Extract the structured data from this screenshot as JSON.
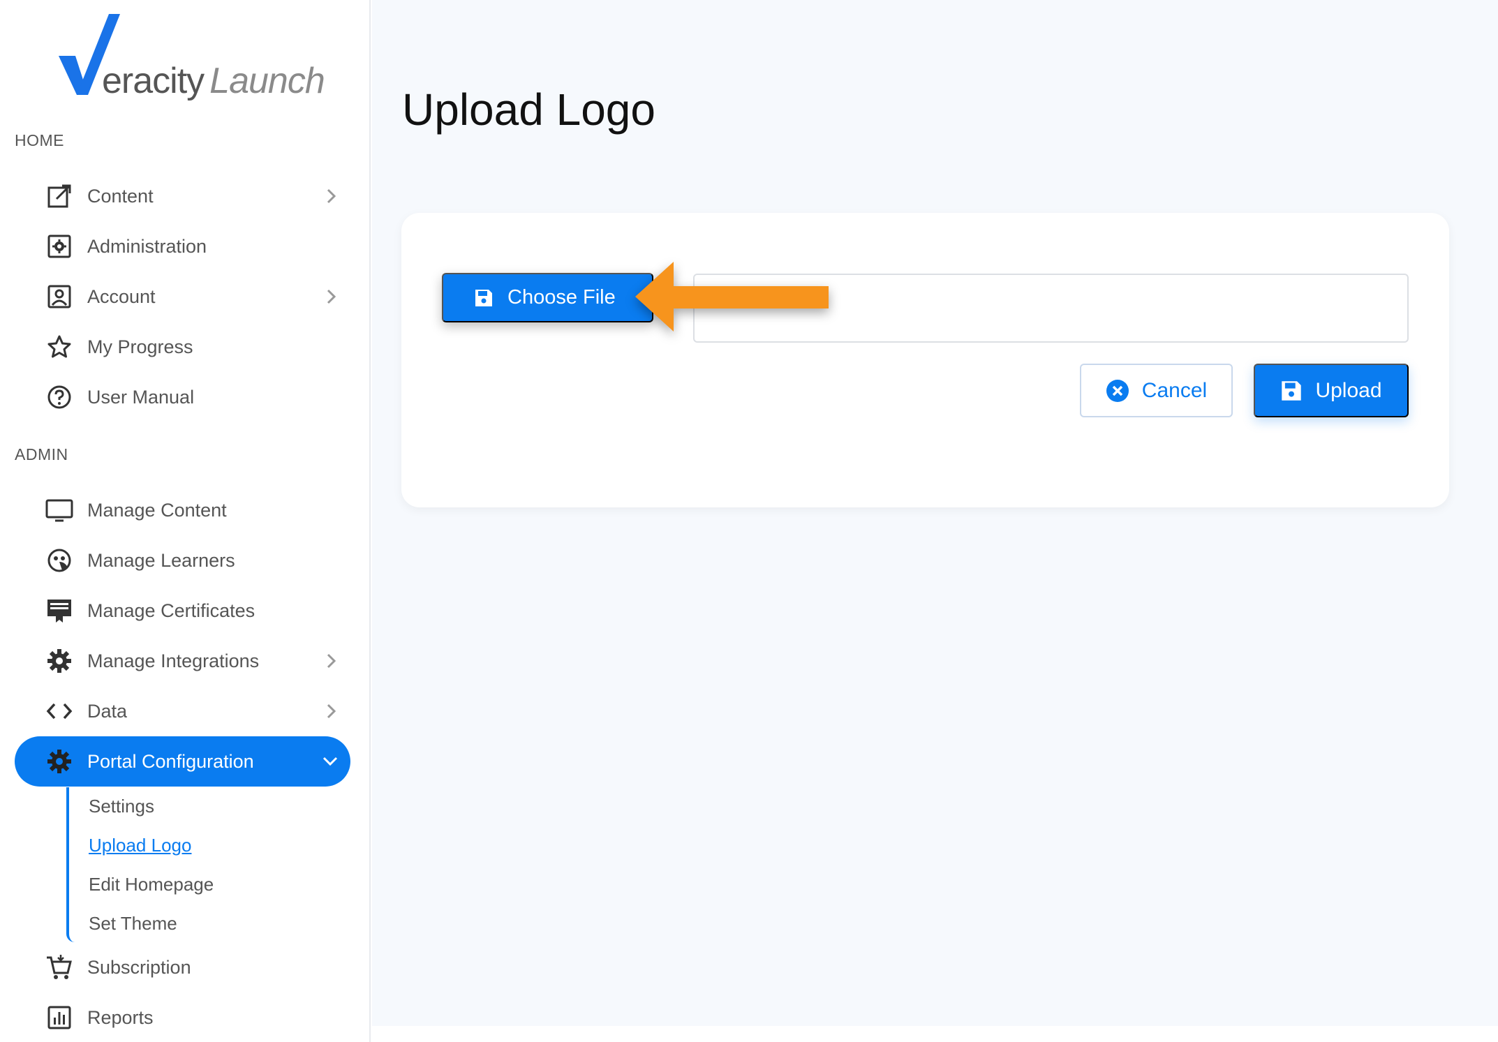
{
  "logo": {
    "brand_main": "eracity",
    "brand_suffix": "Launch",
    "accent": "#1a73e8"
  },
  "sidebar": {
    "home_label": "HOME",
    "admin_label": "ADMIN",
    "home_items": [
      {
        "label": "Content",
        "icon": "external-edit-icon",
        "has_chevron": true
      },
      {
        "label": "Administration",
        "icon": "gear-square-icon",
        "has_chevron": false
      },
      {
        "label": "Account",
        "icon": "user-square-icon",
        "has_chevron": true
      },
      {
        "label": "My Progress",
        "icon": "star-icon",
        "has_chevron": false
      },
      {
        "label": "User Manual",
        "icon": "question-circle-icon",
        "has_chevron": false
      }
    ],
    "admin_items": [
      {
        "label": "Manage Content",
        "icon": "monitor-icon",
        "has_chevron": false
      },
      {
        "label": "Manage Learners",
        "icon": "users-circle-icon",
        "has_chevron": false
      },
      {
        "label": "Manage Certificates",
        "icon": "certificate-icon",
        "has_chevron": false
      },
      {
        "label": "Manage Integrations",
        "icon": "cog-icon",
        "has_chevron": true
      },
      {
        "label": "Data",
        "icon": "code-icon",
        "has_chevron": true
      },
      {
        "label": "Portal Configuration",
        "icon": "cog-icon",
        "has_chevron": true,
        "active": true
      }
    ],
    "sub_items": [
      {
        "label": "Settings"
      },
      {
        "label": "Upload Logo",
        "current": true
      },
      {
        "label": "Edit Homepage"
      },
      {
        "label": "Set Theme"
      }
    ],
    "bottom_items": [
      {
        "label": "Subscription",
        "icon": "cart-icon"
      },
      {
        "label": "Reports",
        "icon": "bar-chart-icon"
      }
    ]
  },
  "main": {
    "title": "Upload Logo",
    "choose_file_label": "Choose File",
    "file_field_value": "",
    "cancel_label": "Cancel",
    "upload_label": "Upload"
  },
  "colors": {
    "primary": "#0a7cf0",
    "annotation_arrow": "#f7941d"
  }
}
